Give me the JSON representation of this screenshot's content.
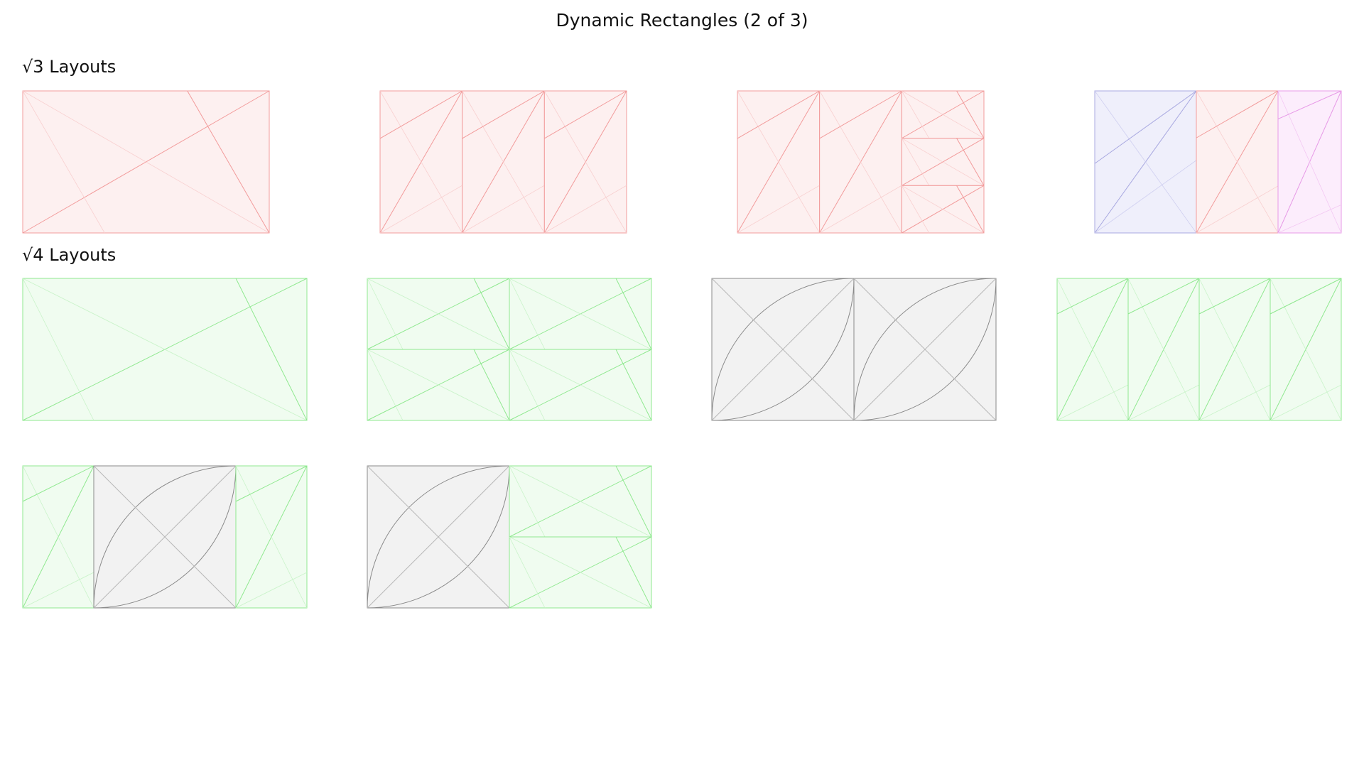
{
  "title": "Dynamic Rectangles (2 of 3)",
  "sections": {
    "sqrt3": {
      "heading": "√3 Layouts"
    },
    "sqrt4": {
      "heading": "√4 Layouts"
    }
  },
  "palette": {
    "red": {
      "fill": "#fdf0f0",
      "line": "#f29b9b",
      "faint": "#f8d0d0"
    },
    "green": {
      "fill": "#f0fcf0",
      "line": "#8fe88f",
      "faint": "#c9f3c9"
    },
    "gray": {
      "fill": "#f2f2f2",
      "line": "#8a8a8a",
      "faint": "#b8b8b8"
    },
    "blue": {
      "fill": "#efeffb",
      "line": "#a8a8e0",
      "faint": "#cfcff0"
    },
    "pink": {
      "fill": "#fcedfc",
      "line": "#e79ae7",
      "faint": "#f3c8f3"
    }
  }
}
